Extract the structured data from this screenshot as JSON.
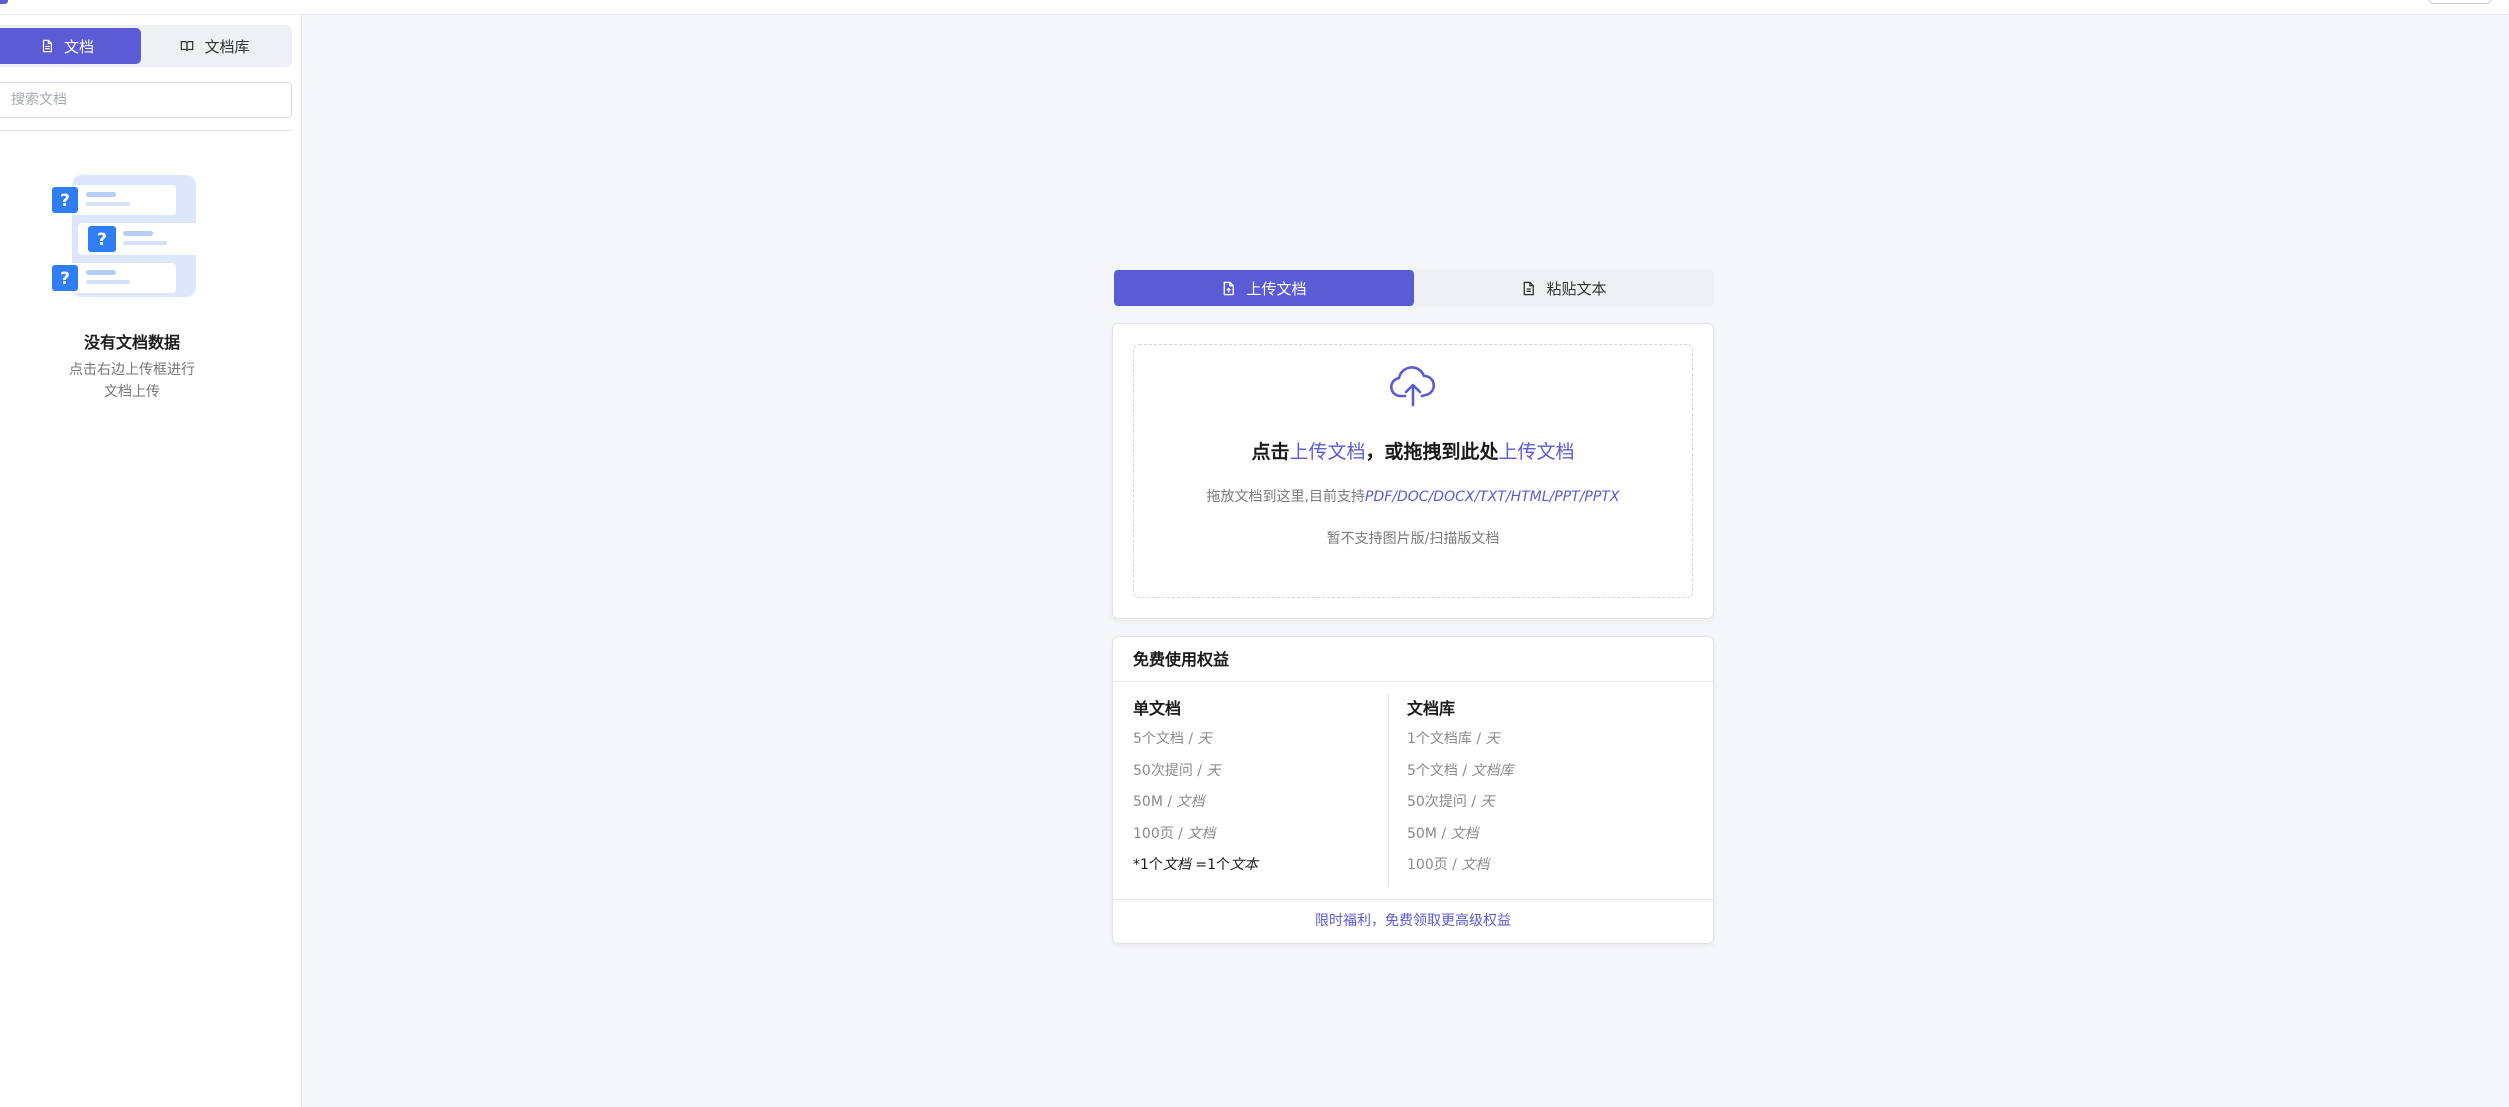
{
  "colors": {
    "accent": "#5b5bd6",
    "icon_blue": "#2f7ef7",
    "muted_text": "#8a8a90",
    "background": "#f6f7fa"
  },
  "sidebar": {
    "tabs": [
      {
        "label": "文档",
        "icon": "document-icon",
        "active": true
      },
      {
        "label": "文档库",
        "icon": "book-icon",
        "active": false
      }
    ],
    "search": {
      "placeholder": "搜索文档",
      "value": ""
    },
    "empty_state": {
      "illustration": "document-question-illustration",
      "title": "没有文档数据",
      "desc_line1": "点击右边上传框进行",
      "desc_line2": "文档上传"
    }
  },
  "main": {
    "tabs": [
      {
        "label": "上传文档",
        "icon": "file-upload-icon",
        "active": true
      },
      {
        "label": "粘贴文本",
        "icon": "file-text-icon",
        "active": false
      }
    ],
    "upload": {
      "icon": "cloud-upload-icon",
      "title_part1": "点击",
      "title_link1": "上传文档",
      "title_part2": "，或拖拽到此处",
      "title_link2": "上传文档",
      "sub_prefix": "拖放文档到这里,目前支持",
      "formats": "PDF/DOC/DOCX/TXT/HTML/PPT/PPTX",
      "note": "暂不支持图片版/扫描版文档"
    },
    "benefits": {
      "title": "免费使用权益",
      "single": {
        "title": "单文档",
        "items": [
          {
            "value": "5个文档 / ",
            "unit": "天"
          },
          {
            "value": "50次提问 / ",
            "unit": "天"
          },
          {
            "value": "50M / ",
            "unit": "文档"
          },
          {
            "value": "100页 / ",
            "unit": "文档"
          }
        ],
        "note_prefix": "*1个",
        "note_italic1": "文档",
        "note_mid": " =1个",
        "note_italic2": "文本"
      },
      "library": {
        "title": "文档库",
        "items": [
          {
            "value": "1个文档库 / ",
            "unit": "天"
          },
          {
            "value": "5个文档 / ",
            "unit": "文档库"
          },
          {
            "value": "50次提问 / ",
            "unit": "天"
          },
          {
            "value": "50M / ",
            "unit": "文档"
          },
          {
            "value": "100页 / ",
            "unit": "文档"
          }
        ]
      },
      "footer_link": "限时福利，免费领取更高级权益"
    }
  }
}
